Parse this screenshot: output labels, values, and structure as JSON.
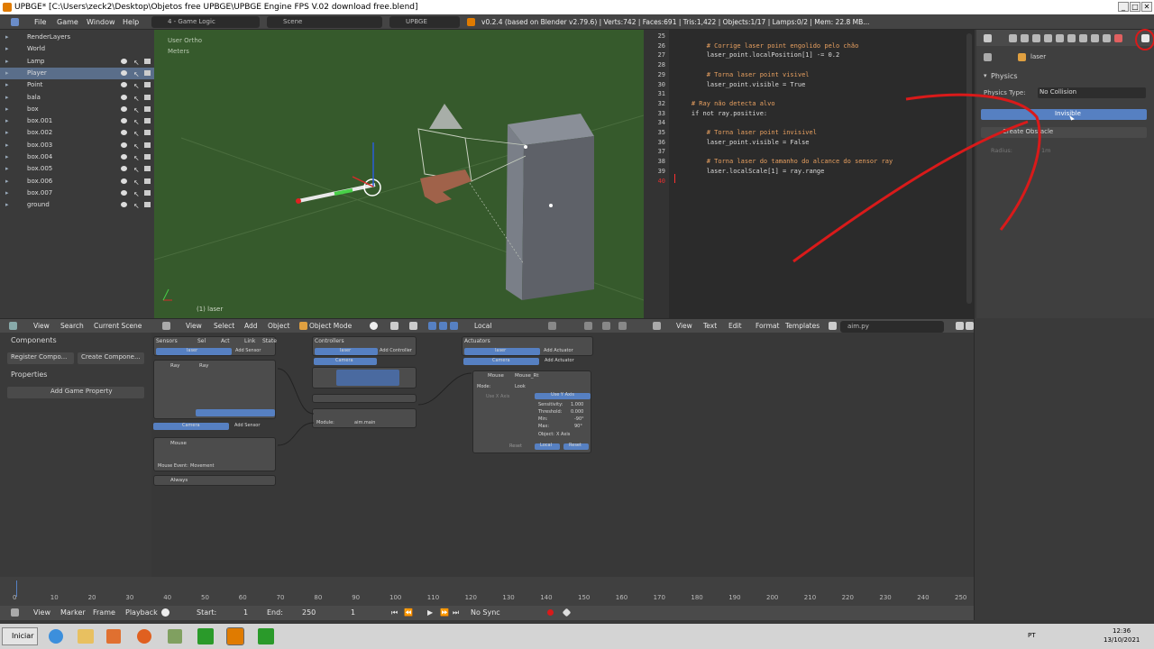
{
  "window": {
    "title": "UPBGE* [C:\\Users\\zeck2\\Desktop\\Objetos free UPBGE\\UPBGE Engine FPS V.02 download free.blend]",
    "buttons": [
      "_",
      "□",
      "✕"
    ]
  },
  "infobar": {
    "menus": [
      "File",
      "Game",
      "Window",
      "Help"
    ],
    "screen_layout": "4 - Game Logic",
    "scene": "Scene",
    "engine": "UPBGE",
    "stats": "v0.2.4 (based on Blender v2.79.6) | Verts:742 | Faces:691 | Tris:1,422 | Objects:1/17 | Lamps:0/2 | Mem: 22.8 MB..."
  },
  "outliner": {
    "items": [
      {
        "label": "RenderLayers"
      },
      {
        "label": "World"
      },
      {
        "label": "Lamp"
      },
      {
        "label": "Player"
      },
      {
        "label": "Point"
      },
      {
        "label": "bala"
      },
      {
        "label": "box"
      },
      {
        "label": "box.001"
      },
      {
        "label": "box.002"
      },
      {
        "label": "box.003"
      },
      {
        "label": "box.004"
      },
      {
        "label": "box.005"
      },
      {
        "label": "box.006"
      },
      {
        "label": "box.007"
      },
      {
        "label": "ground"
      }
    ]
  },
  "viewport": {
    "view_name": "User Ortho",
    "units": "Meters",
    "object_label": "(1) laser",
    "header": {
      "menus": [
        "View",
        "Select",
        "Add",
        "Object"
      ],
      "mode": "Object Mode",
      "pivot": "Local"
    }
  },
  "text_editor": {
    "lines": [
      {
        "n": "25",
        "text": "",
        "comment": false
      },
      {
        "n": "26",
        "text": "        # Corrige laser point engolido pelo chão",
        "comment": true
      },
      {
        "n": "27",
        "text": "        laser_point.localPosition[1] -= 0.2",
        "comment": false
      },
      {
        "n": "28",
        "text": "",
        "comment": false
      },
      {
        "n": "29",
        "text": "        # Torna laser point visivel",
        "comment": true
      },
      {
        "n": "30",
        "text": "        laser_point.visible = True",
        "comment": false
      },
      {
        "n": "31",
        "text": "",
        "comment": false
      },
      {
        "n": "32",
        "text": "    # Ray não detecta alvo",
        "comment": true
      },
      {
        "n": "33",
        "text": "    if not ray.positive:",
        "comment": false
      },
      {
        "n": "34",
        "text": "",
        "comment": false
      },
      {
        "n": "35",
        "text": "        # Torna laser point invisivel",
        "comment": true
      },
      {
        "n": "36",
        "text": "        laser_point.visible = False",
        "comment": false
      },
      {
        "n": "37",
        "text": "",
        "comment": false
      },
      {
        "n": "38",
        "text": "        # Torna laser do tamanho do alcance do sensor ray",
        "comment": true
      },
      {
        "n": "39",
        "text": "        laser.localScale[1] = ray.range",
        "comment": false
      },
      {
        "n": "40",
        "text": "",
        "comment": false
      }
    ],
    "header": {
      "menus": [
        "View",
        "Text",
        "Edit",
        "Format",
        "Templates"
      ],
      "filename": "aim.py"
    }
  },
  "properties": {
    "object_name": "laser",
    "panel_title": "Physics",
    "physics_type_label": "Physics Type:",
    "physics_type_value": "No Collision",
    "invisible_label": "Invisible",
    "create_obstacle_label": "Create Obstacle",
    "radius_label": "Radius:",
    "radius_value": "1m"
  },
  "lower_left": {
    "header": {
      "menus": [
        "View",
        "Search"
      ],
      "scene": "Current Scene"
    },
    "components_title": "Components",
    "register_component": "Register Compo...",
    "create_component": "Create Compone...",
    "properties_title": "Properties",
    "add_game_property": "Add Game Property"
  },
  "logic": {
    "sensors_title": "Sensors",
    "controllers_title": "Controllers",
    "actuators_title": "Actuators",
    "filter_labels": [
      "Sel",
      "Act",
      "Link",
      "State"
    ],
    "laser_name": "laser",
    "camera_name": "Camera",
    "add_sensor": "Add Sensor",
    "add_controller": "Add Controller",
    "add_actuator": "Add Actuator",
    "ray_sensor": "Ray",
    "ray_field": "Ray",
    "mouse_sensor": "Mouse",
    "always_sensor": "Always",
    "mouse_event": "Mouse Event:",
    "movement": "Movement",
    "module_label": "Module:",
    "module_value": "aim.main",
    "mouse_actuator": "Mouse",
    "mouse_actuator_name": "Mouse_Rt",
    "mode_label": "Mode:",
    "mode_value": "Look",
    "use_x_axis": "Use X Axis",
    "use_y_axis": "Use Y Axis",
    "sensitivity": "Sensitivity:",
    "sensitivity_value": "1.000",
    "threshold": "Threshold:",
    "threshold_value": "0.000",
    "min": "Min:",
    "min_value": "-90°",
    "max": "Max:",
    "max_value": "90°",
    "object_axis": "Object:",
    "axis_value": "X Axis",
    "local_button": "Local",
    "reset_button": "Reset"
  },
  "timeline": {
    "ticks": [
      "0",
      "10",
      "20",
      "30",
      "40",
      "50",
      "60",
      "70",
      "80",
      "90",
      "100",
      "110",
      "120",
      "130",
      "140",
      "150",
      "160",
      "170",
      "180",
      "190",
      "200",
      "210",
      "220",
      "230",
      "240",
      "250"
    ],
    "header_menus": [
      "View",
      "Marker",
      "Frame",
      "Playback"
    ],
    "start_label": "Start:",
    "start_value": "1",
    "end_label": "End:",
    "end_value": "250",
    "current_frame": "1",
    "sync": "No Sync"
  },
  "taskbar": {
    "start_label": "Iniciar",
    "language": "PT",
    "time": "12:36",
    "date": "13/10/2021"
  },
  "colors": {
    "accent_red": "#d91a1a",
    "select_blue": "#5680c2",
    "viewport_green": "#365a2c"
  }
}
